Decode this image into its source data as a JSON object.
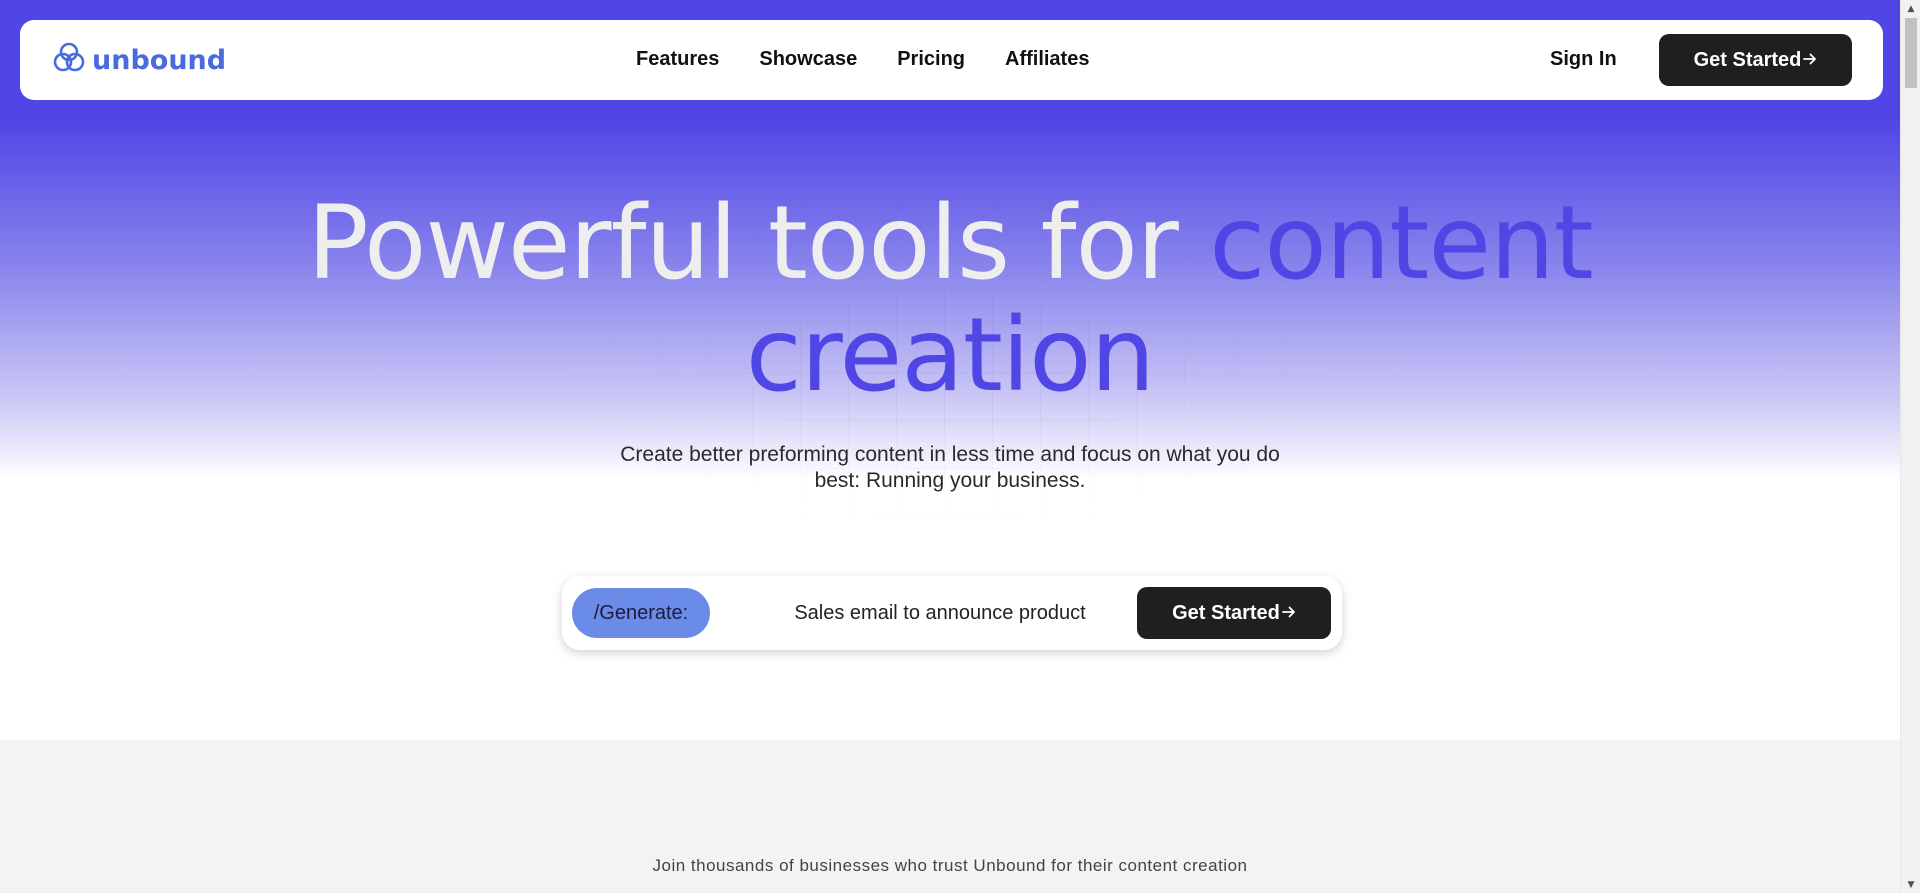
{
  "brand": {
    "name": "unbound",
    "logo_icon": "unbound-logo-icon",
    "accent_color": "#4f46e5",
    "logo_color": "#4a6ae0"
  },
  "nav": {
    "links": [
      {
        "label": "Features"
      },
      {
        "label": "Showcase"
      },
      {
        "label": "Pricing"
      },
      {
        "label": "Affiliates"
      }
    ],
    "signin_label": "Sign In",
    "cta_label": "Get Started",
    "cta_icon": "arrow-right-icon"
  },
  "hero": {
    "headline_plain": "Powerful tools for ",
    "headline_accent_1": "content",
    "headline_accent_2": "creation",
    "subtitle": "Create better preforming content in less time and focus on what you do best: Running your business."
  },
  "generate": {
    "pill_label": "/Generate:",
    "input_value": "Sales email to announce product",
    "cta_label": "Get Started",
    "cta_icon": "arrow-right-icon"
  },
  "trust": {
    "text": "Join thousands of businesses who trust Unbound for their content creation"
  }
}
